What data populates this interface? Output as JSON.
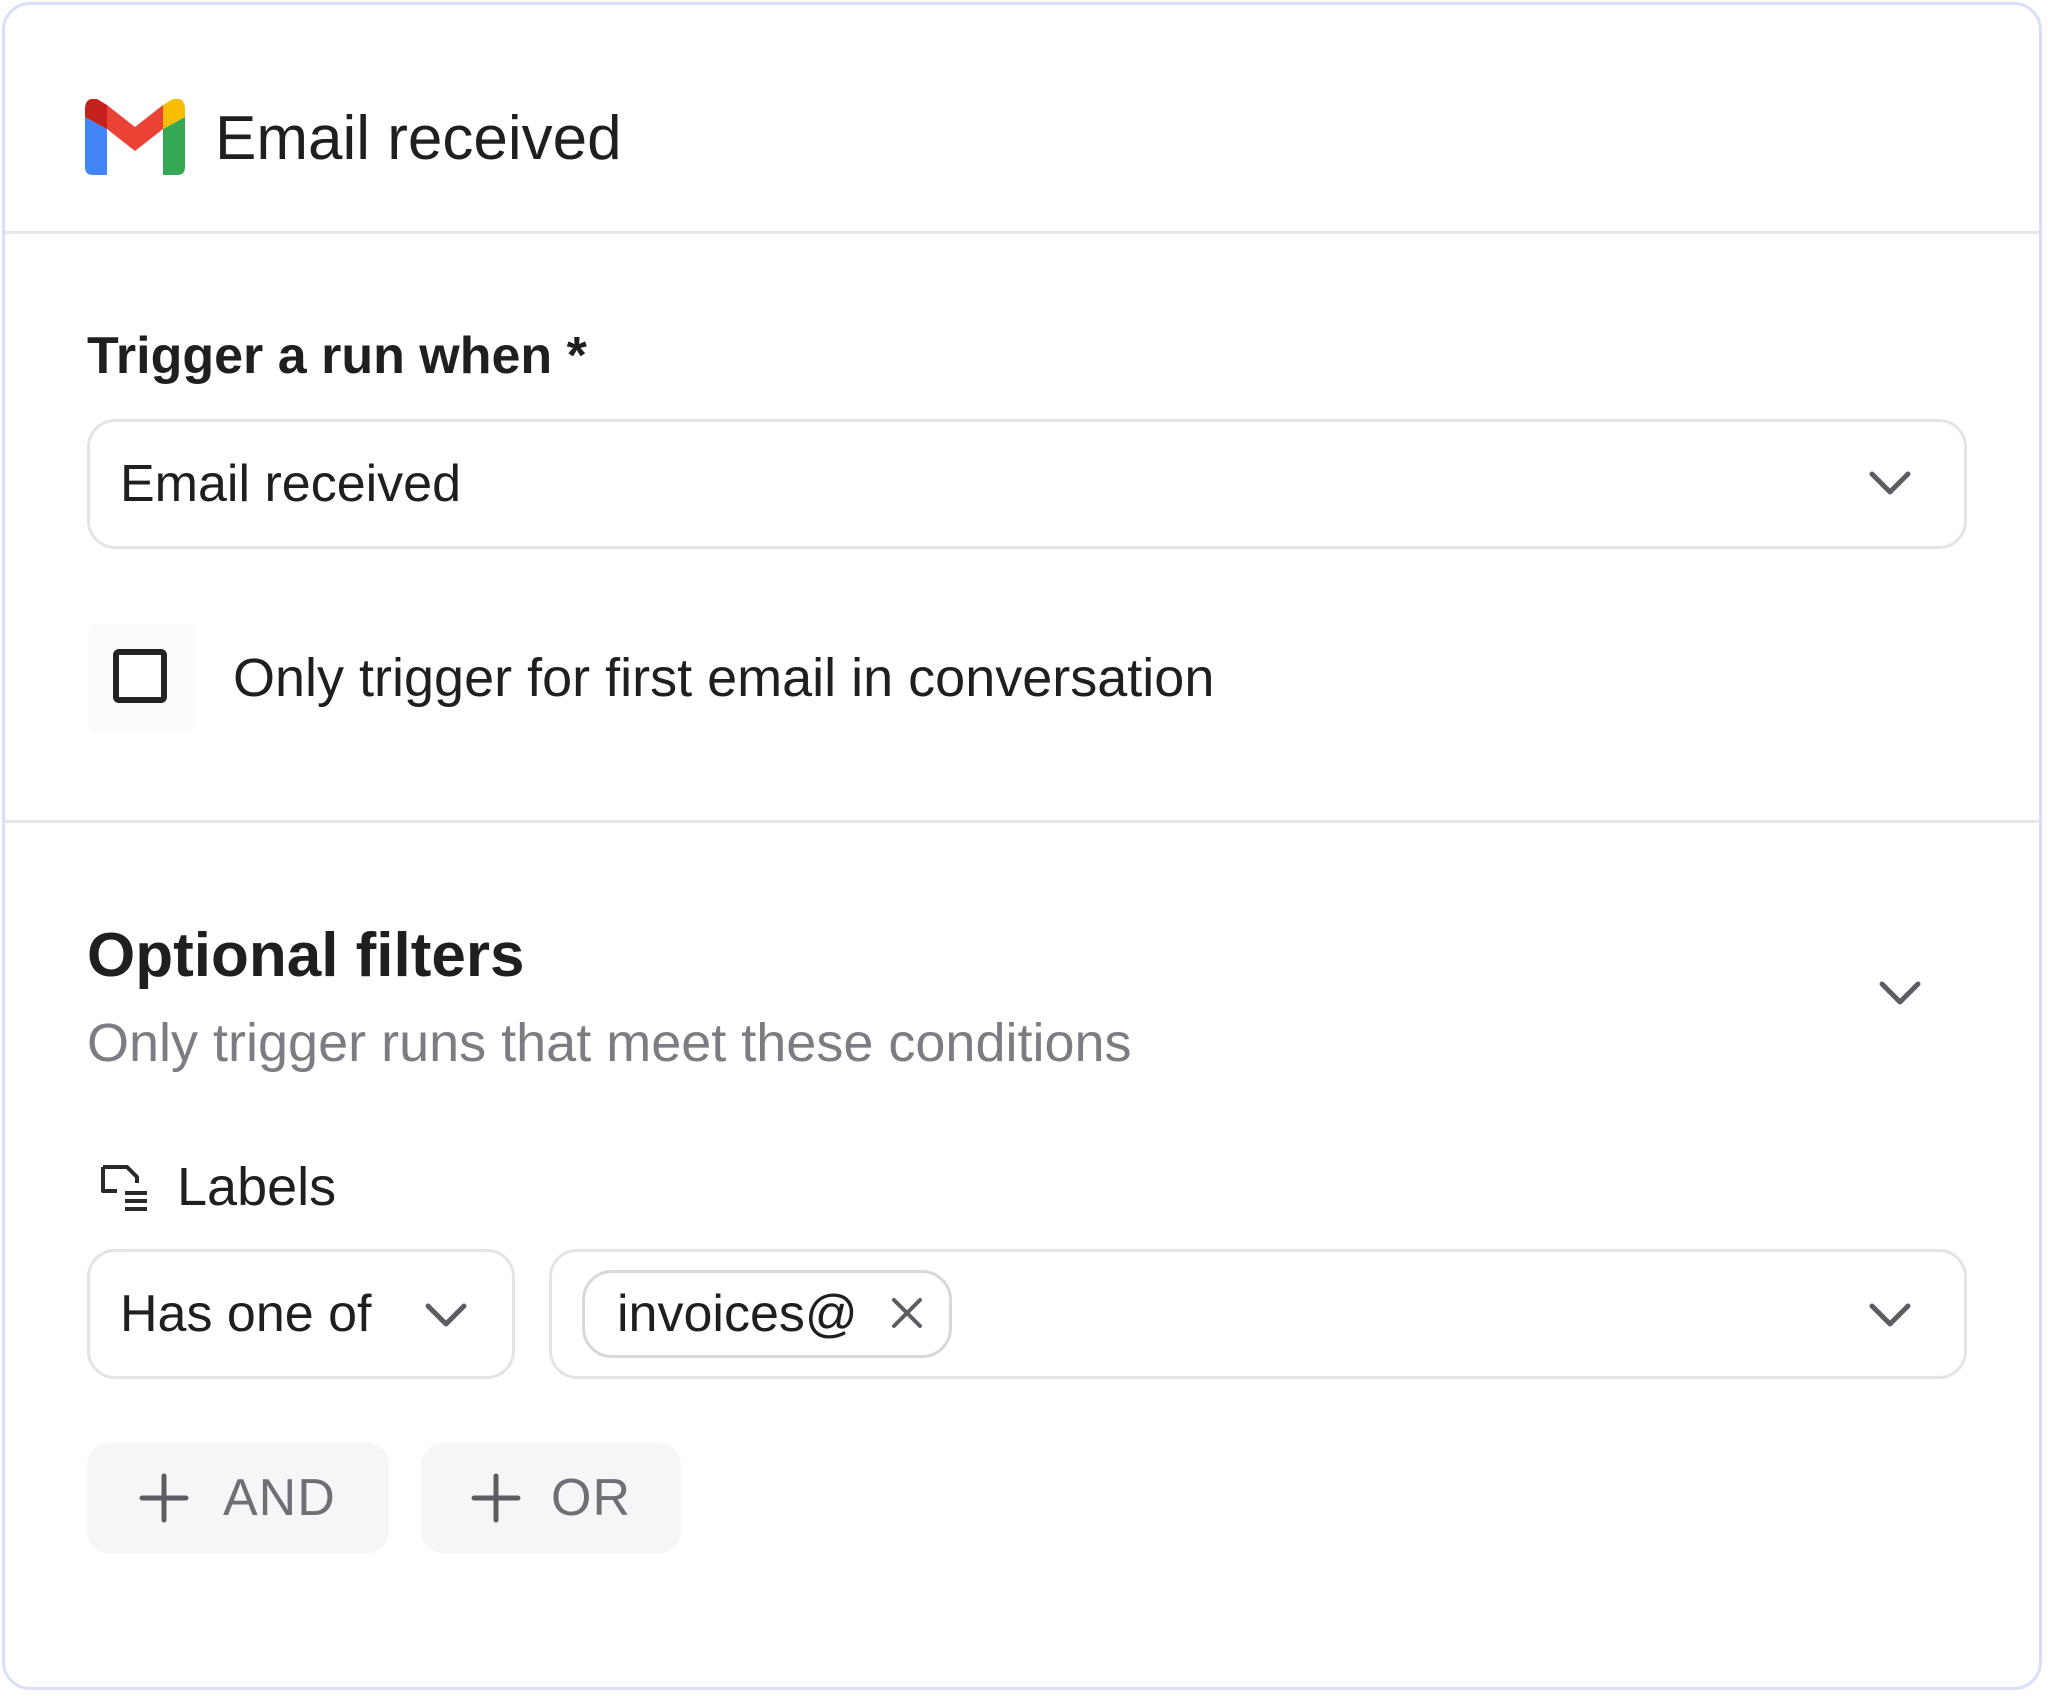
{
  "header": {
    "title": "Email received",
    "app_icon": "gmail-icon"
  },
  "trigger": {
    "label": "Trigger a run when *",
    "selected": "Email received",
    "first_email_only": {
      "label": "Only trigger for first email in conversation",
      "checked": false
    }
  },
  "filters": {
    "title": "Optional filters",
    "subtitle": "Only trigger runs that meet these conditions",
    "labels": {
      "title": "Labels",
      "operator": "Has one of",
      "values": [
        "invoices@"
      ]
    },
    "add_and_label": "AND",
    "add_or_label": "OR"
  },
  "colors": {
    "card_border": "#d9defa",
    "gmail_red": "#ea4335",
    "gmail_blue": "#4285f4",
    "gmail_green": "#34a853",
    "gmail_yellow": "#fbbc04"
  }
}
